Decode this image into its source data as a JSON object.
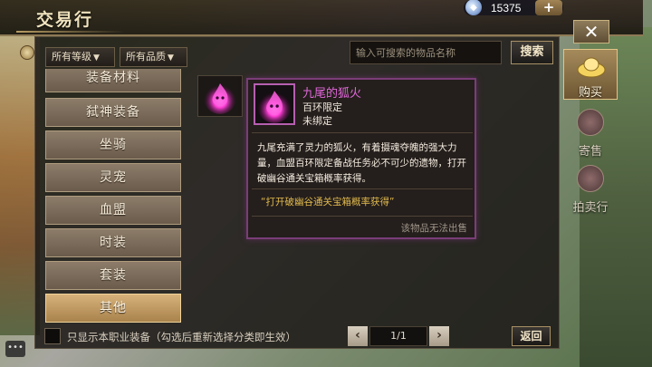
{
  "header": {
    "title": "交易行",
    "currency_amount": "15375",
    "plus_label": "+",
    "close_label": "✕"
  },
  "filters": {
    "level_dropdown": "所有等级",
    "quality_dropdown": "所有品质",
    "search_placeholder": "输入可搜索的物品名称",
    "search_button": "搜索"
  },
  "categories": [
    {
      "label": "装备材料",
      "selected": false
    },
    {
      "label": "弑神装备",
      "selected": false
    },
    {
      "label": "坐骑",
      "selected": false
    },
    {
      "label": "灵宠",
      "selected": false
    },
    {
      "label": "血盟",
      "selected": false
    },
    {
      "label": "时装",
      "selected": false
    },
    {
      "label": "套装",
      "selected": false
    },
    {
      "label": "其他",
      "selected": true
    }
  ],
  "tooltip": {
    "item_name": "九尾的狐火",
    "limit": "百环限定",
    "bind_status": "未绑定",
    "description": "九尾充满了灵力的狐火，有着摄魂夺魄的强大力量，血盟百环限定备战任务必不可少的遗物，打开破幽谷通关宝箱概率获得。",
    "source": "“打开破幽谷通关宝箱概率获得”",
    "unsellable": "该物品无法出售"
  },
  "side_tabs": {
    "buy": "购买",
    "consign": "寄售",
    "auction": "拍卖行"
  },
  "footer": {
    "checkbox_label": "只显示本职业装备（勾选后重新选择分类即生效）",
    "page": "1/1",
    "prev": "‹",
    "next": "›",
    "back_button": "返回"
  },
  "colors": {
    "accent_gold": "#d7b27a",
    "tooltip_border": "#7a3d78",
    "item_name": "#df68d8",
    "source_text": "#e0b94d"
  }
}
